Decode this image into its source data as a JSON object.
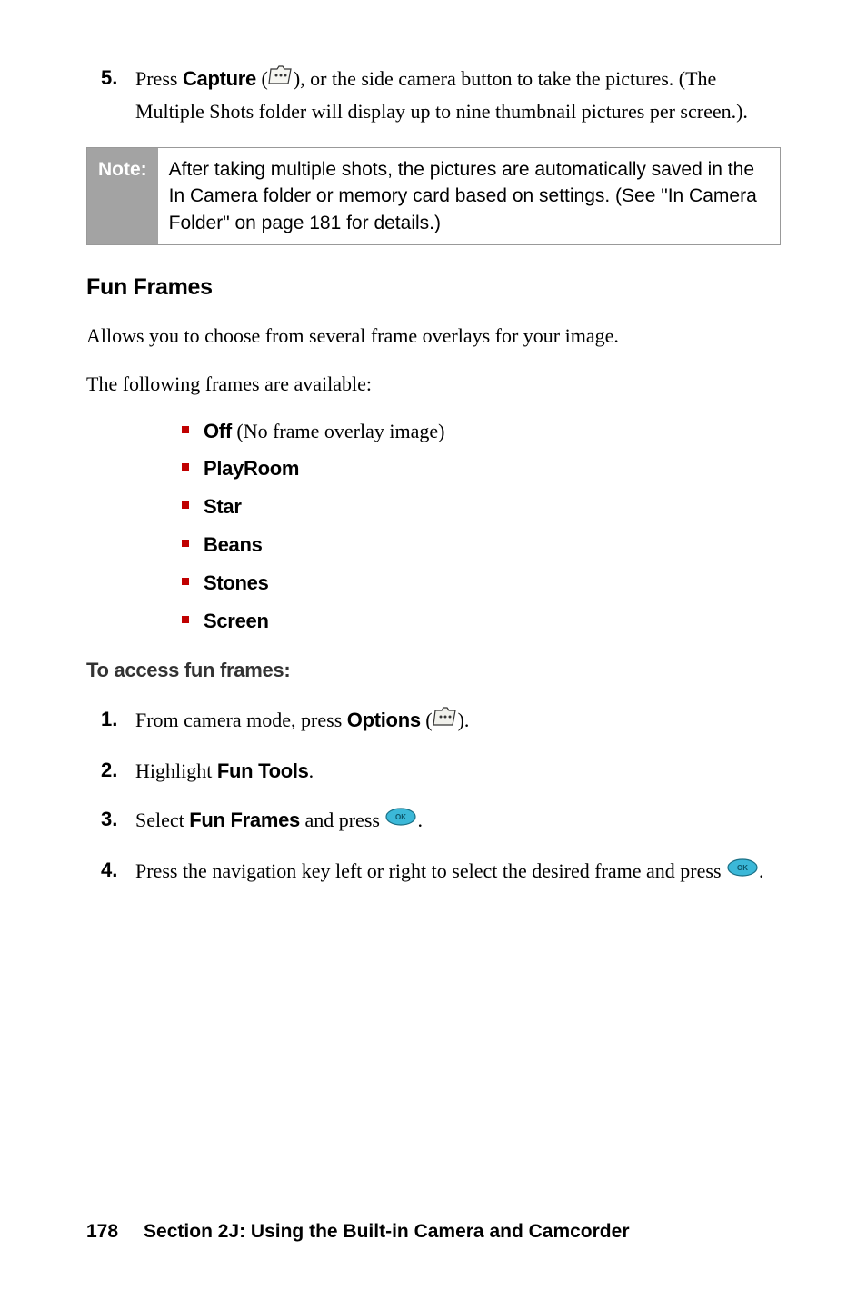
{
  "step5": {
    "num": "5.",
    "text_a": "Press ",
    "capture": "Capture",
    "text_b": " (",
    "text_c": "), or the side camera button to take the pictures. (The Multiple Shots folder will display up to nine thumbnail pictures per screen.)."
  },
  "note": {
    "label": "Note:",
    "body": "After taking multiple shots, the pictures are automatically saved in the In Camera folder or memory card based on settings. (See \"In Camera Folder\" on page 181 for details.)"
  },
  "h2": "Fun Frames",
  "para1": "Allows you to choose from several frame overlays for your image.",
  "para2": "The following frames are available:",
  "bullets": [
    {
      "bold": "Off",
      "rest": " (No frame overlay image)"
    },
    {
      "bold": "PlayRoom",
      "rest": ""
    },
    {
      "bold": "Star",
      "rest": ""
    },
    {
      "bold": "Beans",
      "rest": ""
    },
    {
      "bold": "Stones",
      "rest": ""
    },
    {
      "bold": "Screen",
      "rest": ""
    }
  ],
  "subhead": "To access fun frames:",
  "b1": {
    "num": "1.",
    "a": "From camera mode, press ",
    "b": "Options",
    "c": " (",
    "d": ")."
  },
  "b2": {
    "num": "2.",
    "a": "Highlight ",
    "b": "Fun Tools",
    "c": "."
  },
  "b3": {
    "num": "3.",
    "a": "Select ",
    "b": "Fun Frames",
    "c": " and press ",
    "d": "."
  },
  "b4": {
    "num": "4.",
    "a": "Press the navigation key left or right to select the desired frame and press ",
    "b": "."
  },
  "footer": {
    "page": "178",
    "title": "Section 2J: Using the Built-in Camera and Camcorder"
  }
}
